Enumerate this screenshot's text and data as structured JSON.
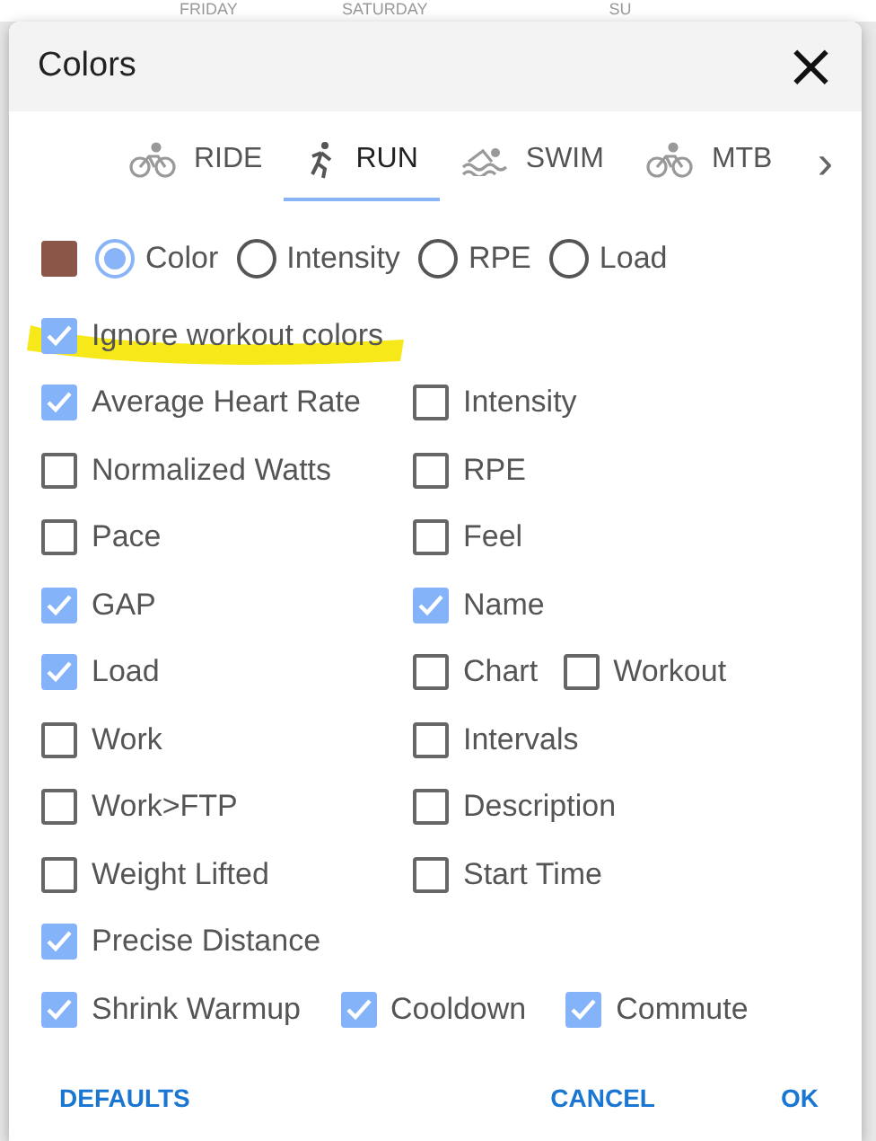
{
  "background": {
    "day_headers": [
      "FRIDAY",
      "SATURDAY",
      "SU"
    ]
  },
  "dialog": {
    "title": "Colors",
    "close": "×",
    "tabs": [
      {
        "label": "RIDE",
        "kind": "bike",
        "selected": false
      },
      {
        "label": "RUN",
        "kind": "run",
        "selected": true
      },
      {
        "label": "SWIM",
        "kind": "swim",
        "selected": false
      },
      {
        "label": "MTB",
        "kind": "bike",
        "selected": false
      }
    ],
    "tab_scroll": "›",
    "swatch": {
      "color": "#8b5547"
    },
    "color_modes": [
      {
        "label": "Color",
        "selected": true
      },
      {
        "label": "Intensity",
        "selected": false
      },
      {
        "label": "RPE",
        "selected": false
      },
      {
        "label": "Load",
        "selected": false
      }
    ],
    "ignore": {
      "label": "Ignore workout colors",
      "checked": true,
      "highlighted": true
    },
    "rows": [
      {
        "kind": "columns",
        "items": [
          {
            "label": "Average Heart Rate",
            "checked": true
          },
          {
            "label": "Intensity",
            "checked": false
          }
        ]
      },
      {
        "kind": "columns",
        "items": [
          {
            "label": "Normalized Watts",
            "checked": false
          },
          {
            "label": "RPE",
            "checked": false
          }
        ]
      },
      {
        "kind": "columns",
        "items": [
          {
            "label": "Pace",
            "checked": false
          },
          {
            "label": "Feel",
            "checked": false
          }
        ]
      },
      {
        "kind": "columns",
        "items": [
          {
            "label": "GAP",
            "checked": true
          },
          {
            "label": "Name",
            "checked": true
          }
        ]
      },
      {
        "kind": "columns",
        "items": [
          {
            "label": "Load",
            "checked": true
          },
          {
            "label": "Chart",
            "checked": false
          },
          {
            "label": "Workout",
            "checked": false
          }
        ]
      },
      {
        "kind": "columns",
        "items": [
          {
            "label": "Work",
            "checked": false
          },
          {
            "label": "Intervals",
            "checked": false
          }
        ]
      },
      {
        "kind": "columns",
        "items": [
          {
            "label": "Work>FTP",
            "checked": false
          },
          {
            "label": "Description",
            "checked": false
          }
        ]
      },
      {
        "kind": "columns",
        "items": [
          {
            "label": "Weight Lifted",
            "checked": false
          },
          {
            "label": "Start Time",
            "checked": false
          }
        ]
      },
      {
        "kind": "columns",
        "items": [
          {
            "label": "Precise Distance",
            "checked": true
          }
        ]
      },
      {
        "kind": "inline",
        "items": [
          {
            "label": "Shrink Warmup",
            "checked": true
          },
          {
            "label": "Cooldown",
            "checked": true
          },
          {
            "label": "Commute",
            "checked": true
          }
        ]
      }
    ],
    "buttons": [
      {
        "label": "DEFAULTS"
      },
      {
        "label": "CANCEL"
      },
      {
        "label": "OK"
      }
    ]
  }
}
